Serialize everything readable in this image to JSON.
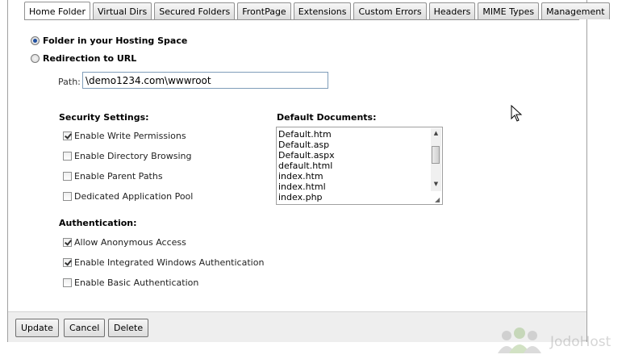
{
  "tabs": [
    {
      "label": "Home Folder",
      "active": true
    },
    {
      "label": "Virtual Dirs",
      "active": false
    },
    {
      "label": "Secured Folders",
      "active": false
    },
    {
      "label": "FrontPage",
      "active": false
    },
    {
      "label": "Extensions",
      "active": false
    },
    {
      "label": "Custom Errors",
      "active": false
    },
    {
      "label": "Headers",
      "active": false
    },
    {
      "label": "MIME Types",
      "active": false
    },
    {
      "label": "Management",
      "active": false
    }
  ],
  "folder_type": {
    "option_folder": "Folder in your Hosting Space",
    "option_redirect": "Redirection to URL",
    "selected": "folder"
  },
  "path": {
    "label": "Path:",
    "value": "\\demo1234.com\\wwwroot"
  },
  "security": {
    "title": "Security Settings:",
    "items": [
      {
        "label": "Enable Write Permissions",
        "checked": true
      },
      {
        "label": "Enable Directory Browsing",
        "checked": false
      },
      {
        "label": "Enable Parent Paths",
        "checked": false
      },
      {
        "label": "Dedicated Application Pool",
        "checked": false
      }
    ]
  },
  "authentication": {
    "title": "Authentication:",
    "items": [
      {
        "label": "Allow Anonymous Access",
        "checked": true
      },
      {
        "label": "Enable Integrated Windows Authentication",
        "checked": true
      },
      {
        "label": "Enable Basic Authentication",
        "checked": false
      }
    ]
  },
  "default_documents": {
    "title": "Default Documents:",
    "items": [
      "Default.htm",
      "Default.asp",
      "Default.aspx",
      "default.html",
      "index.htm",
      "index.html",
      "index.php"
    ]
  },
  "buttons": {
    "update": "Update",
    "cancel": "Cancel",
    "delete": "Delete"
  },
  "watermark": {
    "text": "JodoHost"
  }
}
